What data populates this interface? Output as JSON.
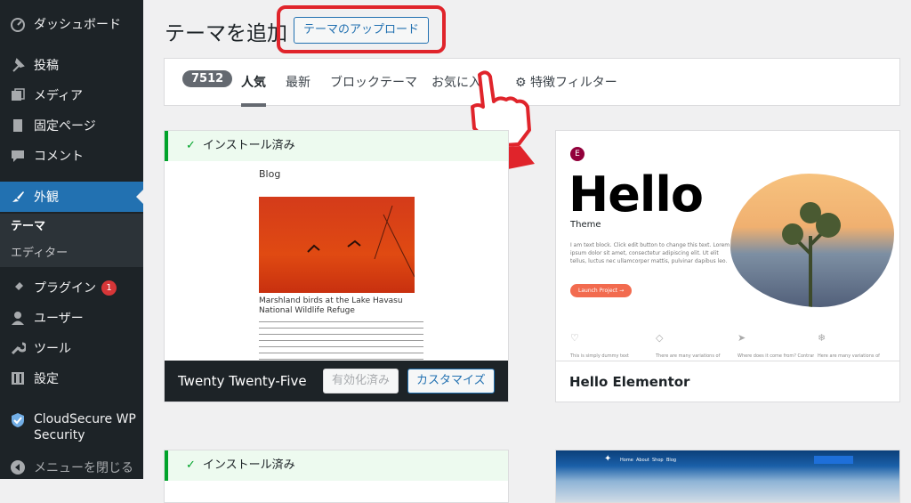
{
  "sidebar": {
    "items": [
      {
        "label": "ダッシュボード",
        "icon": "dashboard-icon"
      },
      {
        "label": "投稿",
        "icon": "pin-icon"
      },
      {
        "label": "メディア",
        "icon": "media-icon"
      },
      {
        "label": "固定ページ",
        "icon": "page-icon"
      },
      {
        "label": "コメント",
        "icon": "comment-icon"
      },
      {
        "label": "外観",
        "icon": "brush-icon"
      },
      {
        "label": "プラグイン",
        "icon": "plugin-icon",
        "badge": "1"
      },
      {
        "label": "ユーザー",
        "icon": "user-icon"
      },
      {
        "label": "ツール",
        "icon": "wrench-icon"
      },
      {
        "label": "設定",
        "icon": "settings-icon"
      },
      {
        "label": "CloudSecure WP Security",
        "icon": "shield-icon"
      },
      {
        "label": "メニューを閉じる",
        "icon": "collapse-icon"
      }
    ],
    "submenu": [
      "テーマ",
      "エディター"
    ]
  },
  "header": {
    "title": "テーマを追加",
    "upload_label": "テーマのアップロード"
  },
  "filters": {
    "count": "7512",
    "tabs": [
      "人気",
      "最新",
      "ブロックテーマ",
      "お気に入り"
    ],
    "feature_filter": "特徴フィルター"
  },
  "themes": [
    {
      "installed_label": "インストール済み",
      "name": "Twenty Twenty-Five",
      "activated_label": "有効化済み",
      "customize_label": "カスタマイズ",
      "preview": {
        "blog": "Blog",
        "caption": "Marshland birds at the Lake Havasu National Wildlife Refuge"
      }
    },
    {
      "name": "Hello Elementor",
      "preview": {
        "logo": "E",
        "hello": "Hello",
        "theme": "Theme",
        "body": "I am text block. Click edit button to change this text. Lorem ipsum dolor sit amet, consectetur adipiscing elit. Ut elit tellus, luctus nec ullamcorper mattis, pulvinar dapibus leo.",
        "launch": "Launch Project →",
        "features": [
          "This is simply dummy text",
          "There are many variations of",
          "Where does it come from? Contrary",
          "Here are many variations of"
        ]
      }
    },
    {
      "installed_label": "インストール済み"
    },
    {
      "nav": [
        "Home",
        "About",
        "Shop",
        "Blog"
      ]
    }
  ],
  "colors": {
    "accent": "#2271b1",
    "sidebar": "#1d2327",
    "highlight": "#e0242b"
  }
}
